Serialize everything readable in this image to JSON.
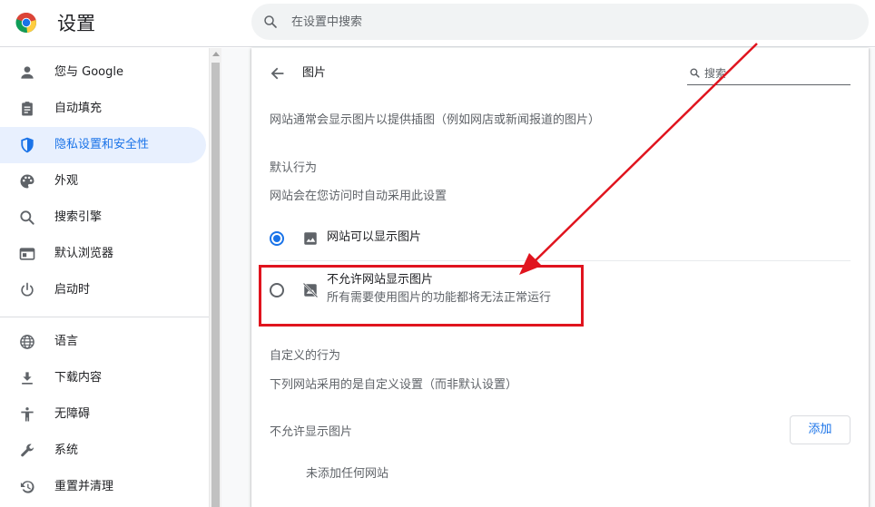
{
  "header": {
    "title": "设置",
    "search_placeholder": "在设置中搜索"
  },
  "sidebar": {
    "items": [
      {
        "label": "您与 Google",
        "icon": "person-icon"
      },
      {
        "label": "自动填充",
        "icon": "clipboard-icon"
      },
      {
        "label": "隐私设置和安全性",
        "icon": "shield-icon",
        "active": true
      },
      {
        "label": "外观",
        "icon": "palette-icon"
      },
      {
        "label": "搜索引擎",
        "icon": "search-icon"
      },
      {
        "label": "默认浏览器",
        "icon": "browser-icon"
      },
      {
        "label": "启动时",
        "icon": "power-icon"
      },
      {
        "label": "语言",
        "icon": "globe-icon"
      },
      {
        "label": "下载内容",
        "icon": "download-icon"
      },
      {
        "label": "无障碍",
        "icon": "accessibility-icon"
      },
      {
        "label": "系统",
        "icon": "wrench-icon"
      },
      {
        "label": "重置并清理",
        "icon": "restore-icon"
      }
    ]
  },
  "page": {
    "title": "图片",
    "search_placeholder": "搜索",
    "description": "网站通常会显示图片以提供插图（例如网店或新闻报道的图片）",
    "default_behavior": {
      "heading": "默认行为",
      "subheading": "网站会在您访问时自动采用此设置",
      "option_allow": "网站可以显示图片",
      "option_block": "不允许网站显示图片",
      "option_block_desc": "所有需要使用图片的功能都将无法正常运行"
    },
    "custom_behavior": {
      "heading": "自定义的行为",
      "subheading": "下列网站采用的是自定义设置（而非默认设置）",
      "blocked_heading": "不允许显示图片",
      "add_label": "添加",
      "empty_text": "未添加任何网站"
    }
  },
  "colors": {
    "accent": "#1a73e8",
    "annotation": "#e0141e"
  }
}
